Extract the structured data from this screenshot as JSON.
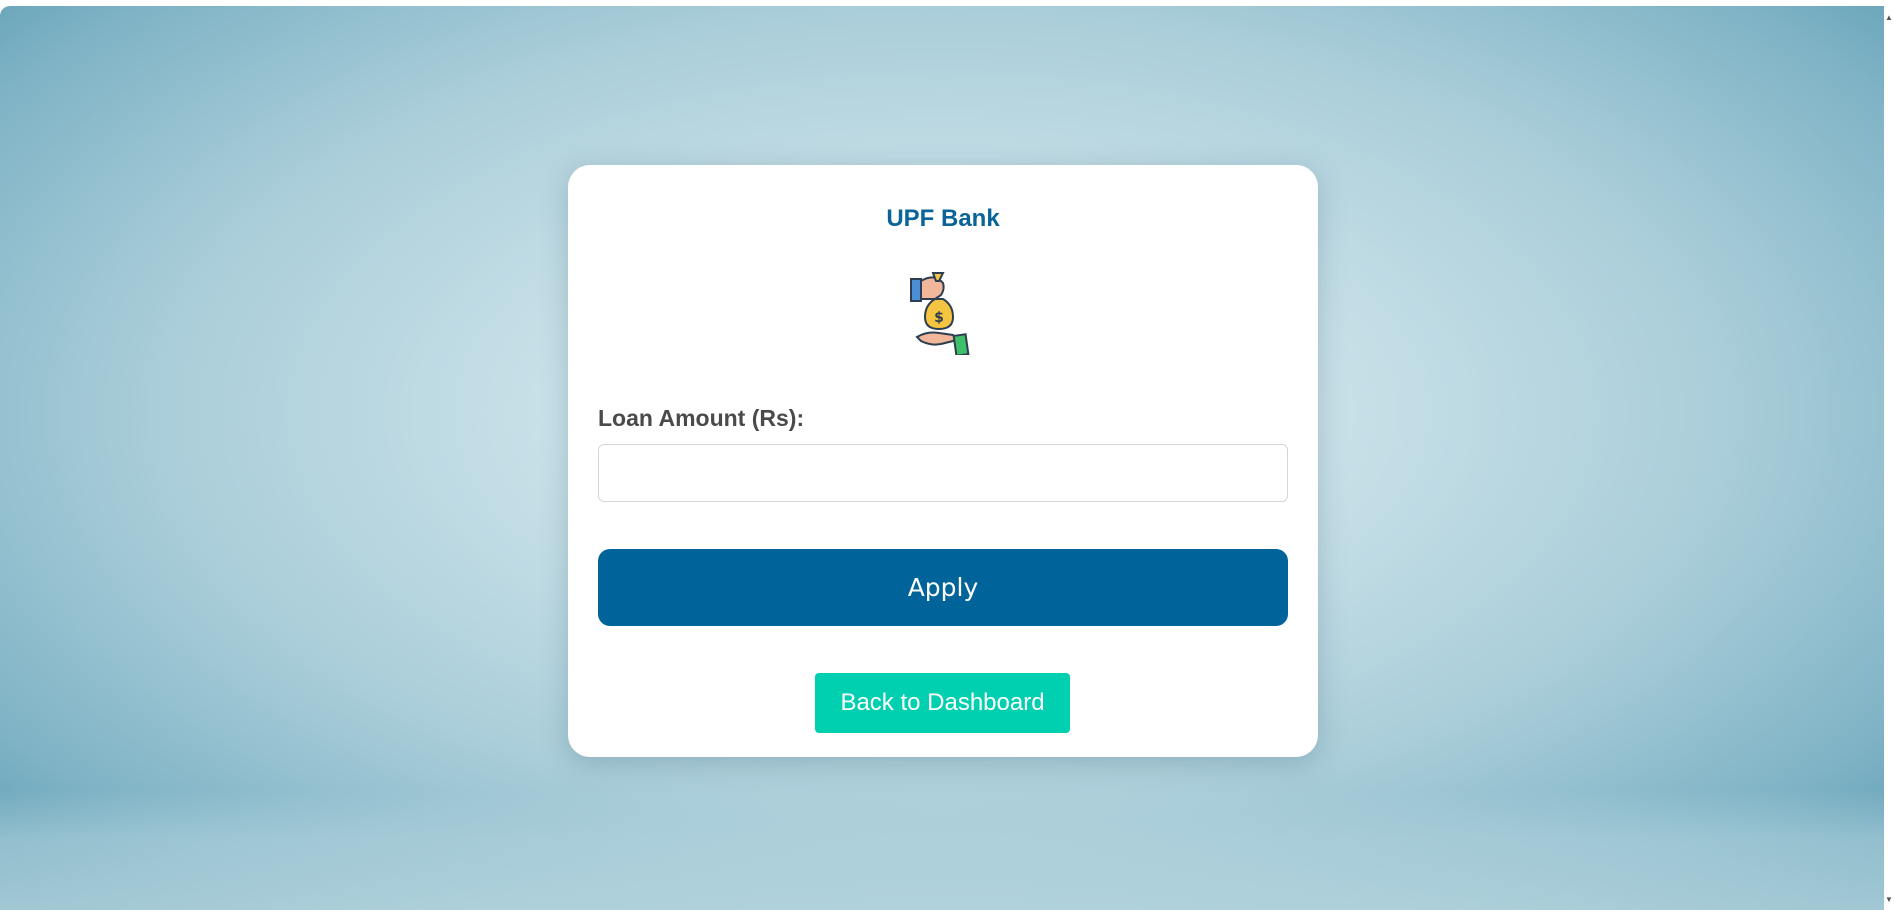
{
  "card": {
    "brand": "UPF Bank",
    "logo_icon": "money-bag-hands-icon",
    "loan_label": "Loan Amount (Rs):",
    "loan_input_value": "",
    "loan_input_placeholder": "",
    "apply_label": "Apply",
    "back_label": "Back to Dashboard"
  },
  "colors": {
    "brand": "#0a6497",
    "apply_button": "#00649b",
    "back_button": "#00cfb0",
    "label_text": "#4a4a4a",
    "background_center": "#d6e8ee",
    "background_edge": "#5e9db3"
  }
}
